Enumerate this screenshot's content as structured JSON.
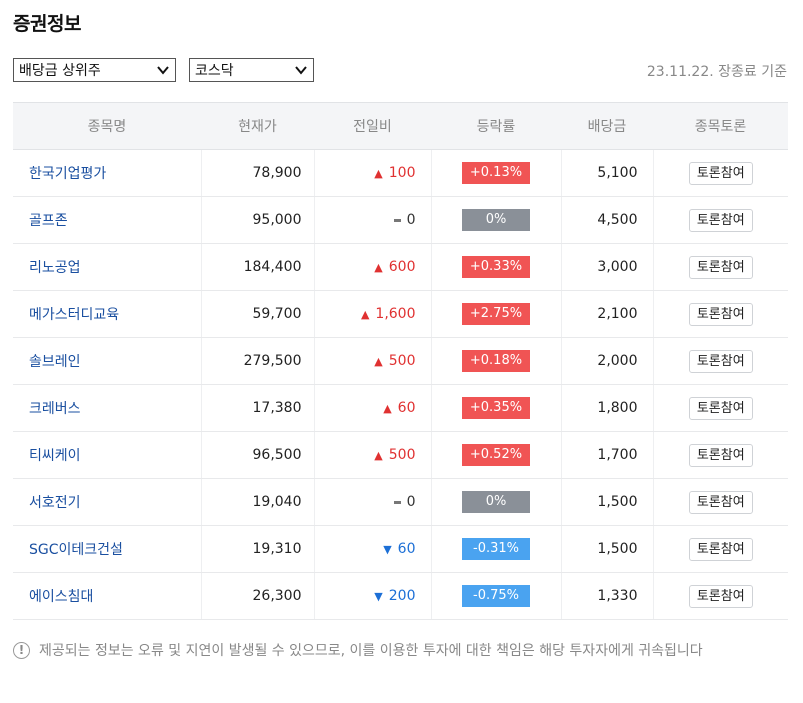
{
  "page": {
    "title": "증권정보"
  },
  "filters": {
    "category_selected": "배당금 상위주",
    "market_selected": "코스닥",
    "date_text": "23.11.22. 장종료 기준"
  },
  "table": {
    "headers": [
      "종목명",
      "현재가",
      "전일비",
      "등락률",
      "배당금",
      "종목토론"
    ],
    "rows": [
      {
        "name": "한국기업평가",
        "price": "78,900",
        "dir": "up",
        "change": "100",
        "rate": "+0.13%",
        "dividend": "5,100",
        "action": "토론참여"
      },
      {
        "name": "골프존",
        "price": "95,000",
        "dir": "flat",
        "change": "0",
        "rate": "0%",
        "dividend": "4,500",
        "action": "토론참여"
      },
      {
        "name": "리노공업",
        "price": "184,400",
        "dir": "up",
        "change": "600",
        "rate": "+0.33%",
        "dividend": "3,000",
        "action": "토론참여"
      },
      {
        "name": "메가스터디교육",
        "price": "59,700",
        "dir": "up",
        "change": "1,600",
        "rate": "+2.75%",
        "dividend": "2,100",
        "action": "토론참여"
      },
      {
        "name": "솔브레인",
        "price": "279,500",
        "dir": "up",
        "change": "500",
        "rate": "+0.18%",
        "dividend": "2,000",
        "action": "토론참여"
      },
      {
        "name": "크레버스",
        "price": "17,380",
        "dir": "up",
        "change": "60",
        "rate": "+0.35%",
        "dividend": "1,800",
        "action": "토론참여"
      },
      {
        "name": "티씨케이",
        "price": "96,500",
        "dir": "up",
        "change": "500",
        "rate": "+0.52%",
        "dividend": "1,700",
        "action": "토론참여"
      },
      {
        "name": "서호전기",
        "price": "19,040",
        "dir": "flat",
        "change": "0",
        "rate": "0%",
        "dividend": "1,500",
        "action": "토론참여"
      },
      {
        "name": "SGC이테크건설",
        "price": "19,310",
        "dir": "down",
        "change": "60",
        "rate": "-0.31%",
        "dividend": "1,500",
        "action": "토론참여"
      },
      {
        "name": "에이스침대",
        "price": "26,300",
        "dir": "down",
        "change": "200",
        "rate": "-0.75%",
        "dividend": "1,330",
        "action": "토론참여"
      }
    ]
  },
  "notice": {
    "icon": "exclamation-icon",
    "text": "제공되는 정보는 오류 및 지연이 발생될 수 있으므로, 이를 이용한 투자에 대한 책임은 해당 투자자에게 귀속됩니다"
  },
  "colors": {
    "up": "#e03131",
    "down": "#1c6fd6",
    "badge_up": "#f05454",
    "badge_down": "#4aa3f0",
    "badge_flat": "#8a9098",
    "link": "#1a4fa0"
  }
}
